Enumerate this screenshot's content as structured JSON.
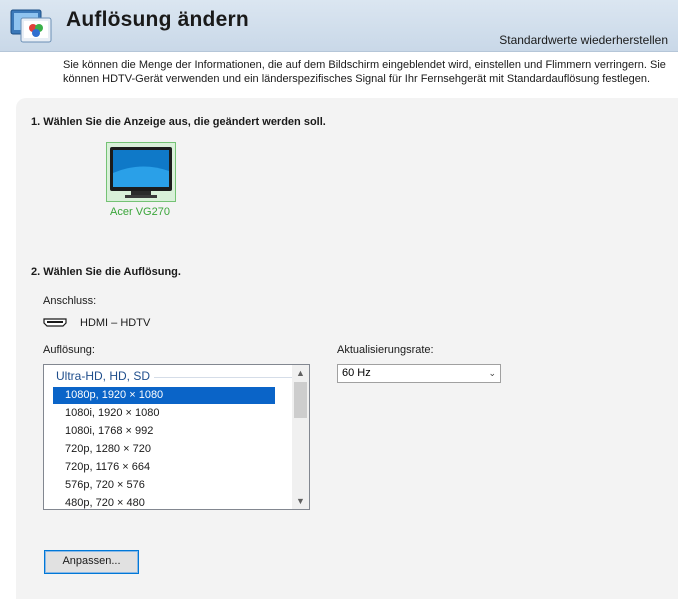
{
  "header": {
    "title": "Auflösung ändern",
    "restore_link": "Standardwerte wiederherstellen"
  },
  "description": "Sie können die Menge der Informationen, die auf dem Bildschirm eingeblendet wird, einstellen und Flimmern verringern. Sie können HDTV-Gerät verwenden und ein länderspezifisches Signal für Ihr Fernsehgerät mit Standardauflösung festlegen.",
  "section1": {
    "title": "1. Wählen Sie die Anzeige aus, die geändert werden soll.",
    "display_name": "Acer VG270"
  },
  "section2": {
    "title": "2. Wählen Sie die Auflösung.",
    "connection_label": "Anschluss:",
    "connection_value": "HDMI – HDTV",
    "resolution_label": "Auflösung:",
    "refresh_label": "Aktualisierungsrate:",
    "resolution_group": "Ultra-HD, HD, SD",
    "resolutions": [
      "1080p, 1920 × 1080",
      "1080i, 1920 × 1080",
      "1080i, 1768 × 992",
      "720p, 1280 × 720",
      "720p, 1176 × 664",
      "576p, 720 × 576",
      "480p, 720 × 480"
    ],
    "selected_resolution": "1080p, 1920 × 1080",
    "refresh_rate": "60 Hz",
    "customize_button": "Anpassen..."
  },
  "icons": {
    "app": "display-settings-icon",
    "monitor": "monitor-icon",
    "connector": "hdmi-connector-icon",
    "scroll_up": "chevron-up-icon",
    "scroll_down": "chevron-down-icon",
    "dropdown": "chevron-down-icon"
  },
  "colors": {
    "header_bg": "#c9d8e8",
    "panel_bg": "#f3f3f3",
    "selection": "#0a64c8",
    "display_selected": "#3aa63a",
    "button_focus": "#0078d7"
  }
}
